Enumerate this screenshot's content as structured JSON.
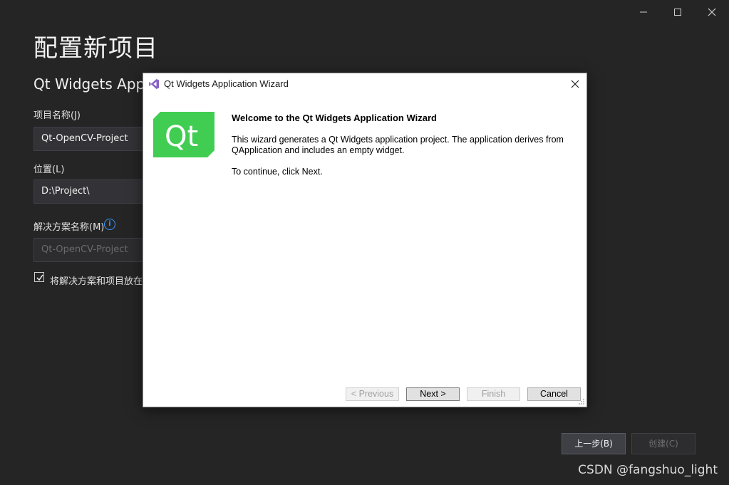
{
  "window": {
    "minimize_icon": "minimize-icon",
    "maximize_icon": "maximize-icon",
    "close_icon": "close-icon"
  },
  "page": {
    "title": "配置新项目",
    "subtitle": "Qt Widgets Appli",
    "project_name_label": "项目名称(J)",
    "project_name_value": "Qt-OpenCV-Project",
    "location_label": "位置(L)",
    "location_value": "D:\\Project\\",
    "solution_name_label": "解决方案名称(M)",
    "solution_name_value": "Qt-OpenCV-Project",
    "same_dir_checkbox_label": "将解决方案和项目放在同",
    "same_dir_checked": true,
    "back_button": "上一步(B)",
    "create_button": "创建(C)"
  },
  "dialog": {
    "title": "Qt Widgets Application Wizard",
    "heading": "Welcome to the Qt Widgets Application Wizard",
    "text_line1": "This wizard generates a Qt Widgets application project. The application derives from",
    "text_line2": "QApplication and includes an empty widget.",
    "text_continue": "To continue, click Next.",
    "logo_text": "Qt",
    "buttons": {
      "previous": "< Previous",
      "next": "Next >",
      "finish": "Finish",
      "cancel": "Cancel"
    }
  },
  "watermark": "CSDN @fangshuo_light",
  "colors": {
    "background": "#252526",
    "qt_green": "#41cd52",
    "vs_purple": "#8661c5",
    "info_blue": "#3794ff"
  }
}
